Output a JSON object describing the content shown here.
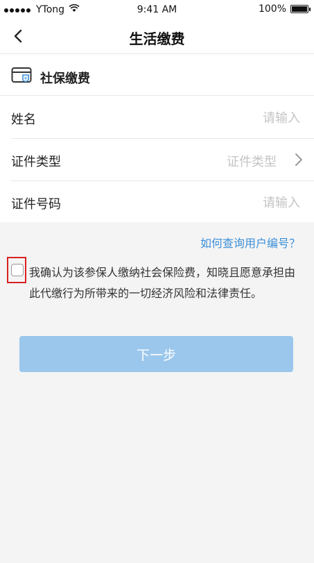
{
  "status_bar": {
    "carrier": "YTong",
    "time": "9:41 AM",
    "battery": "100%"
  },
  "nav": {
    "title": "生活缴费"
  },
  "section": {
    "title": "社保缴费",
    "icon": "card-icon"
  },
  "form": {
    "name": {
      "label": "姓名",
      "placeholder": "请输入",
      "value": ""
    },
    "id_type": {
      "label": "证件类型",
      "value": "证件类型"
    },
    "id_number": {
      "label": "证件号码",
      "placeholder": "请输入",
      "value": ""
    }
  },
  "help_link": "如何查询用户编号？",
  "consent": {
    "checked": false,
    "text": "我确认为该参保人缴纳社会保险费，知晓且愿意承担由此代缴行为所带来的一切经济风险和法律责任。"
  },
  "next_button": {
    "label": "下一步"
  },
  "colors": {
    "accent_link": "#3b8fd8",
    "button_disabled": "#9bc7ec",
    "highlight": "#d82020"
  }
}
